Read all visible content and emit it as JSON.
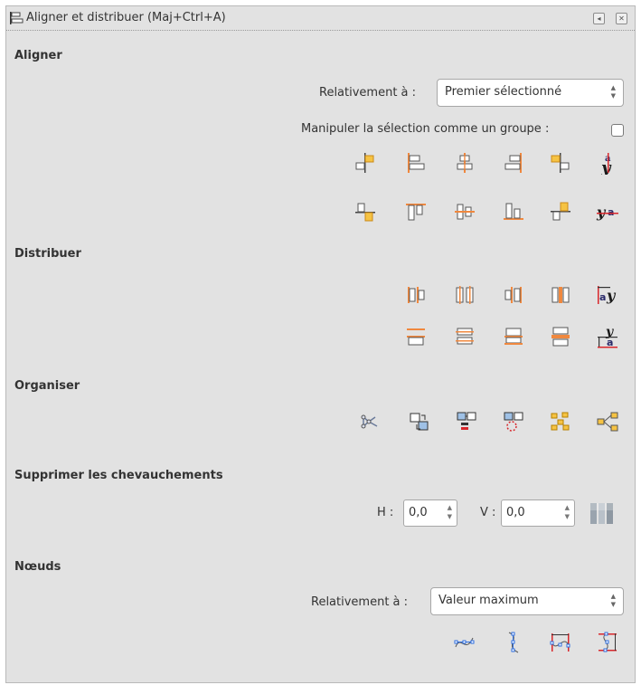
{
  "window": {
    "title": "Aligner et distribuer (Maj+Ctrl+A)",
    "buttons": [
      "◂",
      "✕"
    ]
  },
  "align": {
    "heading": "Aligner",
    "relative_label": "Relativement à :",
    "relative_value": "Premier sélectionné",
    "group_label": "Manipuler la sélection comme un groupe :",
    "group_checked": false,
    "row1_icons": [
      "align-right-to-left-edge-icon",
      "align-left-edges-icon",
      "center-on-vertical-axis-icon",
      "align-right-edges-icon",
      "align-left-to-right-edge-icon",
      "align-baseline-text-horizontal-icon"
    ],
    "row2_icons": [
      "align-bottom-to-top-edge-icon",
      "align-top-edges-icon",
      "center-on-horizontal-axis-icon",
      "align-bottom-edges-icon",
      "align-top-to-bottom-edge-icon",
      "align-baseline-text-vertical-icon"
    ]
  },
  "distribute": {
    "heading": "Distribuer",
    "row1_icons": [
      "distribute-left-edges-icon",
      "distribute-centers-horizontal-icon",
      "distribute-right-edges-icon",
      "distribute-gaps-horizontal-icon",
      "distribute-baseline-horizontal-icon"
    ],
    "row2_icons": [
      "distribute-top-edges-icon",
      "distribute-centers-vertical-icon",
      "distribute-bottom-edges-icon",
      "distribute-gaps-vertical-icon",
      "distribute-baseline-vertical-icon"
    ]
  },
  "arrange": {
    "heading": "Organiser",
    "icons": [
      "graph-layout-icon",
      "exchange-positions-selection-order-icon",
      "exchange-positions-stacking-order-icon",
      "exchange-positions-clockwise-icon",
      "unclump-icon",
      "arrange-connectors-icon"
    ]
  },
  "overlap": {
    "heading": "Supprimer les chevauchements",
    "h_label": "H :",
    "h_value": "0,0",
    "v_label": "V :",
    "v_value": "0,0",
    "apply_icon": "remove-overlaps-icon"
  },
  "nodes": {
    "heading": "Nœuds",
    "relative_label": "Relativement à :",
    "relative_value": "Valeur maximum",
    "icons": [
      "align-nodes-horizontal-icon",
      "align-nodes-vertical-icon",
      "distribute-nodes-horizontal-icon",
      "distribute-nodes-vertical-icon"
    ]
  },
  "colors": {
    "panel": "#e2e2e2",
    "accent_orange": "#f0883e",
    "accent_yellow": "#f6c343",
    "accent_blue": "#2f6fe0",
    "accent_red": "#d8262b"
  }
}
